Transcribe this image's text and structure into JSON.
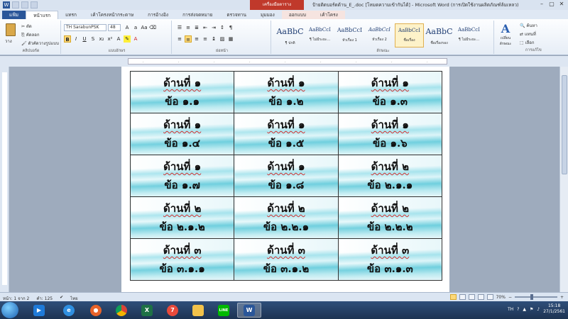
{
  "titlebar": {
    "context_tab": "เครื่องมือตาราง",
    "title": "ป้ายติดบอร์ดด้าน_E_.doc [โหมดความเข้ากันได้] - Microsoft Word (การเปิดใช้งานผลิตภัณฑ์ล้มเหลว)"
  },
  "tabs": [
    "แฟ้ม",
    "หน้าแรก",
    "แทรก",
    "เค้าโครงหน้ากระดาษ",
    "การอ้างอิง",
    "การส่งจดหมาย",
    "ตรวจทาน",
    "มุมมอง",
    "ออกแบบ",
    "เค้าโครง"
  ],
  "ribbon": {
    "clipboard": {
      "paste": "วาง",
      "cut": "ตัด",
      "copy": "คัดลอก",
      "format_painter": "ตัวคัดวางรูปแบบ",
      "label": "คลิปบอร์ด"
    },
    "font": {
      "name": "TH SarabunPSK",
      "size": "48",
      "label": "แบบอักษร"
    },
    "paragraph": {
      "label": "ย่อหน้า"
    },
    "styles": {
      "label": "ลักษณะ",
      "items": [
        {
          "sample": "AaBbC",
          "name": "¶ ปกติ"
        },
        {
          "sample": "AaBbCcI",
          "name": "¶ ไม่มีระยะ..."
        },
        {
          "sample": "AaBbCcI",
          "name": "หัวเรื่อง 1"
        },
        {
          "sample": "AaBbCcI",
          "name": "หัวเรื่อง 2"
        },
        {
          "sample": "AaBbCcI",
          "name": "ชื่อเรื่อง"
        },
        {
          "sample": "AaBbC",
          "name": "ชื่อเรื่องรอง"
        },
        {
          "sample": "AaBbCcI",
          "name": "¶ ไม่มีระยะ..."
        }
      ],
      "change_styles": "เปลี่ยนลักษณะ"
    },
    "editing": {
      "find": "ค้นหา",
      "replace": "แทนที่",
      "select": "เลือก",
      "label": "การแก้ไข"
    }
  },
  "document": {
    "rows": [
      [
        {
          "l1": "ด้านที่ ๑",
          "l2": "ข้อ ๑.๑"
        },
        {
          "l1": "ด้านที่ ๑",
          "l2": "ข้อ ๑.๒"
        },
        {
          "l1": "ด้านที่ ๑",
          "l2": "ข้อ ๑.๓"
        }
      ],
      [
        {
          "l1": "ด้านที่ ๑",
          "l2": "ข้อ ๑.๔"
        },
        {
          "l1": "ด้านที่ ๑",
          "l2": "ข้อ ๑.๕"
        },
        {
          "l1": "ด้านที่ ๑",
          "l2": "ข้อ ๑.๖"
        }
      ],
      [
        {
          "l1": "ด้านที่ ๑",
          "l2": "ข้อ ๑.๗"
        },
        {
          "l1": "ด้านที่ ๑",
          "l2": "ข้อ ๑.๘"
        },
        {
          "l1": "ด้านที่ ๒",
          "l2": "ข้อ ๒.๑.๑"
        }
      ],
      [
        {
          "l1": "ด้านที่ ๒",
          "l2": "ข้อ ๒.๑.๒"
        },
        {
          "l1": "ด้านที่ ๒",
          "l2": "ข้อ ๒.๒.๑"
        },
        {
          "l1": "ด้านที่ ๒",
          "l2": "ข้อ ๒.๒.๒"
        }
      ],
      [
        {
          "l1": "ด้านที่ ๓",
          "l2": "ข้อ ๓.๑.๑"
        },
        {
          "l1": "ด้านที่ ๓",
          "l2": "ข้อ ๓.๑.๒"
        },
        {
          "l1": "ด้านที่ ๓",
          "l2": "ข้อ ๓.๑.๓"
        }
      ]
    ]
  },
  "statusbar": {
    "page": "หน้า: 1 จาก 2",
    "words": "คำ: 125",
    "language": "ไทย",
    "zoom": "70%"
  },
  "taskbar": {
    "time": "15:18",
    "date": "27/1/2561",
    "lang": "TH"
  },
  "colors": {
    "accent": "#2a5699",
    "context_tab": "#c0392b",
    "label_wave": "#3cbed2"
  }
}
